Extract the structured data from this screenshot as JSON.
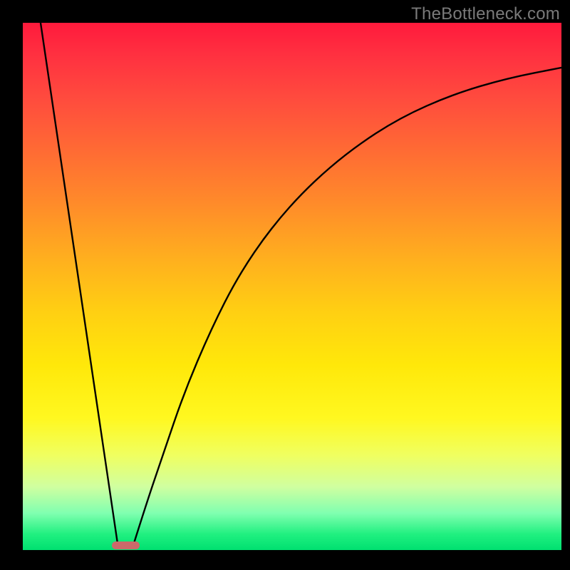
{
  "watermark": "TheBottleneck.com",
  "chart_data": {
    "type": "line",
    "title": "",
    "xlabel": "",
    "ylabel": "",
    "xlim": [
      0,
      100
    ],
    "ylim": [
      0,
      100
    ],
    "grid": false,
    "legend": false,
    "series": [
      {
        "name": "left-line",
        "x": [
          3.3,
          17.6
        ],
        "values": [
          100,
          1.2
        ]
      },
      {
        "name": "right-curve",
        "x": [
          20.6,
          23,
          26,
          30,
          35,
          40,
          46,
          53,
          61,
          70,
          80,
          90,
          100
        ],
        "values": [
          1.2,
          9,
          18,
          30,
          42,
          52,
          61,
          69,
          76,
          82,
          86.5,
          89.5,
          91.5
        ]
      }
    ],
    "marker": {
      "x_center": 19.1,
      "y": 0.9,
      "width_pct": 5.2,
      "height_pct": 1.4
    },
    "background_gradient": {
      "top": "#ff1a3c",
      "mid": "#ffe80a",
      "bottom": "#00e070"
    }
  }
}
